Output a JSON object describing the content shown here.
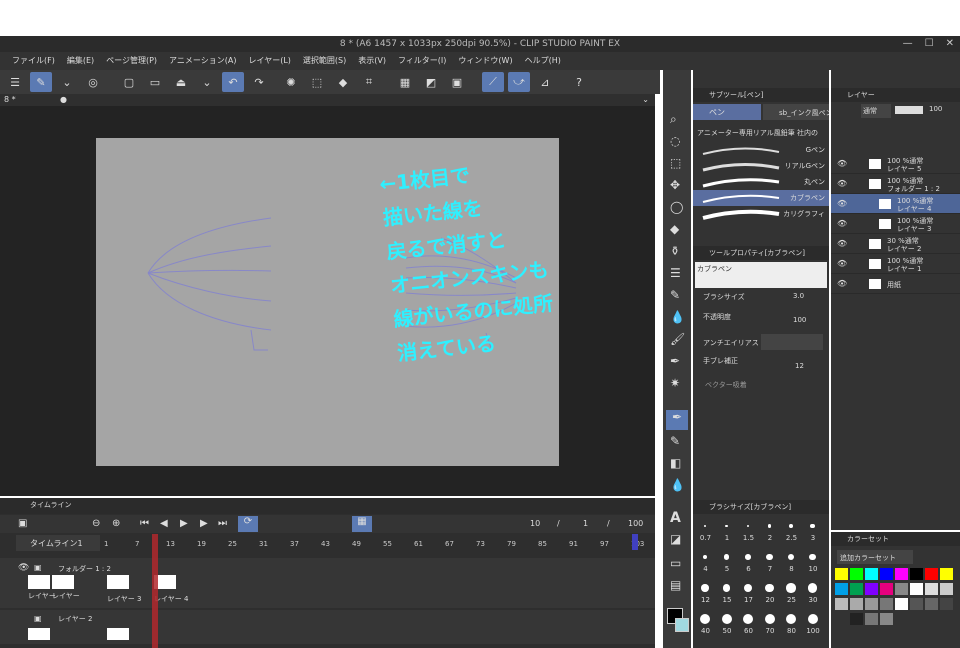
{
  "window": {
    "title": "8 * (A6 1457 x 1033px 250dpi 90.5%) - CLIP STUDIO PAINT EX",
    "controls": [
      "—",
      "☐",
      "✕"
    ]
  },
  "menu": [
    "ファイル(F)",
    "編集(E)",
    "ページ管理(P)",
    "アニメーション(A)",
    "レイヤー(L)",
    "選択範囲(S)",
    "表示(V)",
    "フィルター(I)",
    "ウィンドウ(W)",
    "ヘルプ(H)"
  ],
  "document": {
    "tab": "8 *"
  },
  "annotation": {
    "lines": [
      "←1枚目で",
      "描いた線を",
      "戻るで消すと",
      "オニオンスキンも",
      "線がいるのに処所",
      "消えている"
    ]
  },
  "timeline": {
    "tab_label": "タイムライン",
    "name": "タイムライン1",
    "frame_current": "10",
    "separator": "/",
    "frame_one": "1",
    "total": "100",
    "ruler": [
      "1",
      "7",
      "13",
      "19",
      "25",
      "31",
      "37",
      "43",
      "49",
      "55",
      "61",
      "67",
      "73",
      "79",
      "85",
      "91",
      "97",
      "103"
    ],
    "ruler_top": [
      "0",
      "10",
      "1",
      "2",
      "3",
      "4"
    ],
    "tracks": [
      {
        "name": "フォルダー 1 : 2",
        "cells": [
          "レイヤー",
          "レイヤー",
          "レイヤー 3",
          "レイヤー 4"
        ]
      },
      {
        "name": "レイヤー 2",
        "cells": []
      }
    ]
  },
  "subtool": {
    "panel_title": "サブツール[ペン]",
    "tabs": [
      "ペン",
      "sb_インク風ペン"
    ],
    "group": "アニメーター専用リアル風鉛筆 社内の",
    "items": [
      "Gペン",
      "リアルGペン",
      "丸ペン",
      "カブラペン",
      "カリグラフィ"
    ],
    "selected": "カブラペン"
  },
  "toolprops": {
    "panel_title": "ツールプロパティ[カブラペン]",
    "brush_name": "カブラペン",
    "rows": [
      {
        "label": "ブラシサイズ",
        "value": "3.0"
      },
      {
        "label": "不透明度",
        "value": "100"
      },
      {
        "label": "アンチエイリアス",
        "value": ""
      },
      {
        "label": "手ブレ補正",
        "value": "12"
      },
      {
        "label": "ベクター吸着",
        "value": ""
      }
    ]
  },
  "brushsize": {
    "panel_title": "ブラシサイズ[カブラペン]",
    "sizes": [
      "0.7",
      "1",
      "1.5",
      "2",
      "2.5",
      "3",
      "4",
      "5",
      "6",
      "7",
      "8",
      "10",
      "12",
      "15",
      "17",
      "20",
      "25",
      "30",
      "40",
      "50",
      "60",
      "70",
      "80",
      "100"
    ]
  },
  "layers": {
    "panel_title": "レイヤー",
    "blend": "通常",
    "opacity": "100",
    "rows": [
      {
        "pct": "100 %通常",
        "name": "レイヤー 5"
      },
      {
        "pct": "100 %通常",
        "name": "フォルダー 1 : 2"
      },
      {
        "pct": "100 %通常",
        "name": "レイヤー 4"
      },
      {
        "pct": "100 %通常",
        "name": "レイヤー 3"
      },
      {
        "pct": "30 %通常",
        "name": "レイヤー 2"
      },
      {
        "pct": "100 %通常",
        "name": "レイヤー 1"
      },
      {
        "pct": "",
        "name": "用紙"
      }
    ]
  },
  "colorset": {
    "panel_title": "カラーセット",
    "preset": "追加カラーセット",
    "swatches": [
      "#ffff00",
      "#00ff00",
      "#00ffff",
      "#0000ff",
      "#ff00ff",
      "#000000",
      "#ff0000",
      "#ffff00",
      "#00a0e8",
      "#00a050",
      "#8000ff",
      "#e6007e",
      "#888888",
      "#ffffff",
      "#dddddd",
      "#cccccc",
      "#bbbbbb",
      "#aaaaaa",
      "#999999",
      "#777777",
      "#ffffff",
      "#555555",
      "#666666",
      "#444444",
      "#333333",
      "#222222",
      "#777777",
      "#888888"
    ]
  }
}
